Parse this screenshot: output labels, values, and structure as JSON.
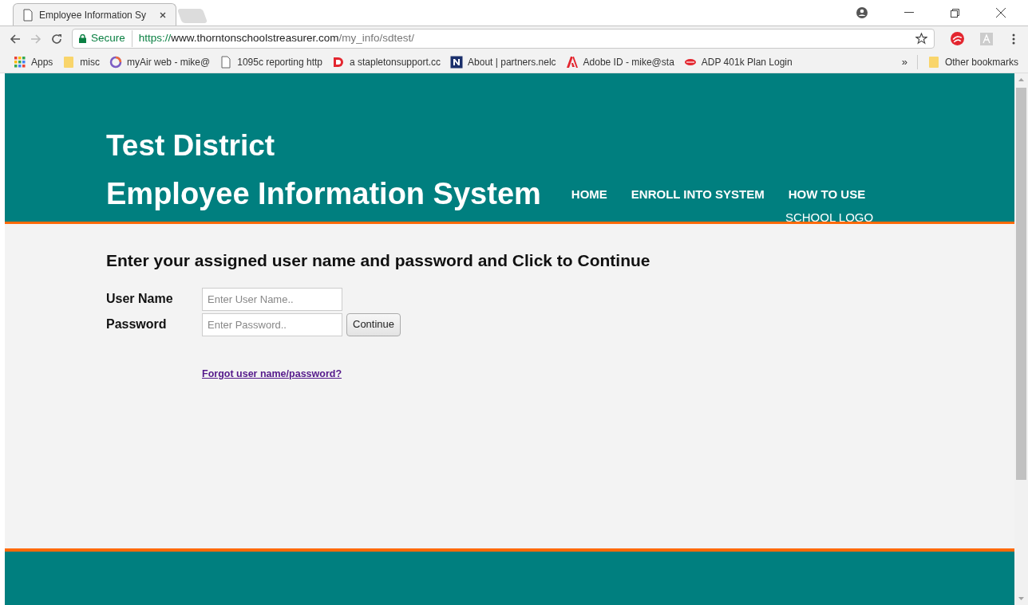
{
  "browser": {
    "tab": {
      "title": "Employee Information Sy"
    },
    "address": {
      "security": "Secure",
      "scheme": "https://",
      "host": "www.thorntonschoolstreasurer.com",
      "path": "/my_info/sdtest/"
    },
    "bookmarks": [
      {
        "kind": "apps",
        "label": "Apps"
      },
      {
        "kind": "folder",
        "label": "misc"
      },
      {
        "kind": "ring",
        "label": "myAir web - mike@"
      },
      {
        "kind": "page",
        "label": "1095c reporting http"
      },
      {
        "kind": "red",
        "label": "a stapletonsupport.cc"
      },
      {
        "kind": "n",
        "label": "About | partners.nelc"
      },
      {
        "kind": "adobe",
        "label": "Adobe ID - mike@sta"
      },
      {
        "kind": "adp",
        "label": "ADP 401k Plan Login"
      }
    ],
    "overflow": "»",
    "other": "Other bookmarks"
  },
  "header": {
    "title": "Test District",
    "subtitle": "Employee Information System",
    "nav": [
      "HOME",
      "ENROLL INTO SYSTEM",
      "HOW TO USE"
    ],
    "logo": "SCHOOL LOGO"
  },
  "login": {
    "heading": "Enter your assigned user name and password and Click to Continue",
    "fields": [
      {
        "label": "User Name",
        "placeholder": "Enter User Name.."
      },
      {
        "label": "Password",
        "placeholder": "Enter Password.."
      }
    ],
    "button": "Continue",
    "link": "Forgot user name/password?"
  }
}
